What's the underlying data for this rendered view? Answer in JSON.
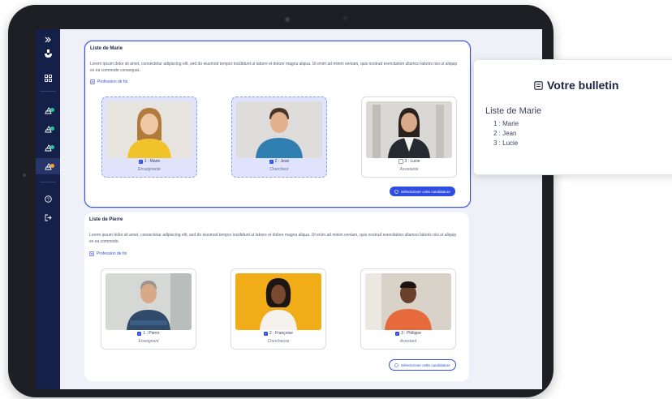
{
  "sidebar": {
    "icons": [
      "chevrons-right-icon",
      "logo-icon",
      "dashboard-icon",
      "vote-icon",
      "vote-icon",
      "vote-icon",
      "vote-icon",
      "help-icon",
      "logout-icon"
    ],
    "status_colors": [
      "#1fc7a0",
      "#1fc7a0",
      "#1fc7a0",
      "#f5a524"
    ]
  },
  "lists": [
    {
      "title": "Liste de Marie",
      "description": "Lorem ipsum dolor sit amet, consectetur adipiscing elit, sed do eiusmod tempor incididunt ut labore et dolore magna aliqua. Ut enim ad minim veniam, quis nostrud exercitation ullamco laboris nisi ut aliquip ex ea commodo consequat..",
      "profession_link": "Profession de foi",
      "select_label": "Sélectionner cette candidature",
      "selected": true,
      "candidates": [
        {
          "label": "1 : Marie",
          "role": "Enseignante",
          "checked": true
        },
        {
          "label": "2 : Jean",
          "role": "Chercheur",
          "checked": true
        },
        {
          "label": "3 : Lucie",
          "role": "Assistante",
          "checked": false
        }
      ]
    },
    {
      "title": "Liste de Pierre",
      "description": "Lorem ipsum dolor sit amet, consectetur adipiscing elit, sed do eiusmod tempor incididunt ut labore et dolore magna aliqua. Ut enim ad minim veniam, quis nostrud exercitation ullamco laboris nisi ut aliquip ex ea commodo.",
      "profession_link": "Profession de foi",
      "select_label": "Sélectionner cette candidature",
      "selected": false,
      "candidates": [
        {
          "label": "1 : Pierre",
          "role": "Enseignant",
          "checked": true
        },
        {
          "label": "2 : Françoise",
          "role": "Chercheuse",
          "checked": true
        },
        {
          "label": "3 : Philippe",
          "role": "Assistant",
          "checked": true
        }
      ]
    }
  ],
  "ballot": {
    "title": "Votre bulletin",
    "list_name": "Liste de Marie",
    "items": [
      "1 : Marie",
      "2 : Jean",
      "3 : Lucie"
    ]
  },
  "colors": {
    "accent": "#2f4de0",
    "sidebar": "#142048",
    "screen_bg": "#f0f1f8"
  }
}
